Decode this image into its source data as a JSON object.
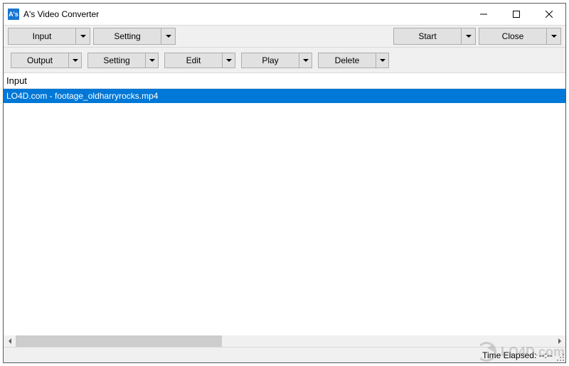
{
  "window": {
    "title": "A's Video Converter",
    "icon_label": "A's"
  },
  "toolbar_top": {
    "input_label": "Input",
    "setting_label": "Setting",
    "start_label": "Start",
    "close_label": "Close"
  },
  "toolbar_sub": {
    "output_label": "Output",
    "setting_label": "Setting",
    "edit_label": "Edit",
    "play_label": "Play",
    "delete_label": "Delete"
  },
  "list": {
    "column_header": "Input",
    "items": [
      {
        "text": "LO4D.com - footage_oldharryrocks.mp4",
        "selected": true
      }
    ]
  },
  "status": {
    "time_elapsed_label": "Time Elapsed:",
    "time_elapsed_value": "--:--"
  },
  "watermark": {
    "text": "LO4D.com"
  },
  "colors": {
    "selection": "#0078d7",
    "toolbar_bg": "#f0f0f0",
    "button_bg": "#e1e1e1",
    "button_border": "#adadad"
  }
}
